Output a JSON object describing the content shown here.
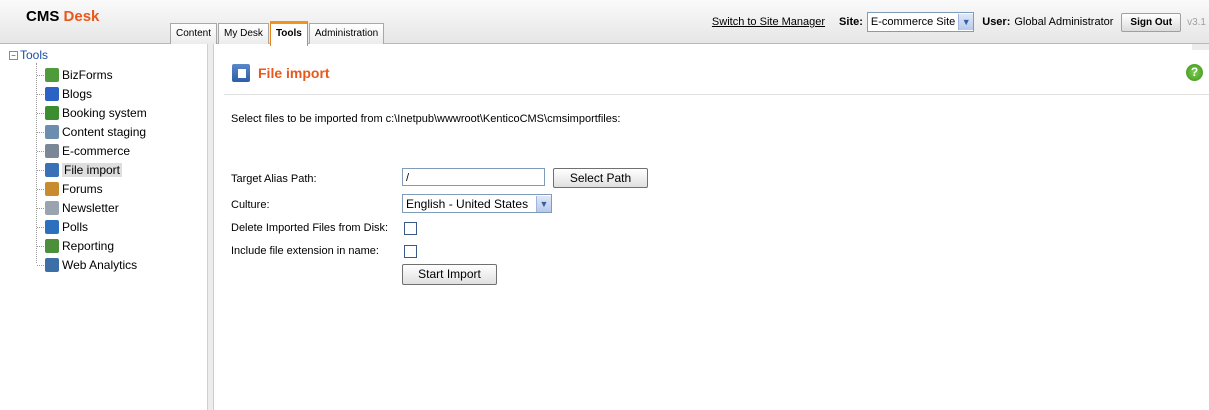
{
  "header": {
    "logo_cms": "CMS",
    "logo_desk": "Desk",
    "tabs": [
      "Content",
      "My Desk",
      "Tools",
      "Administration"
    ],
    "active_tab": "Tools",
    "switch_link": "Switch to Site Manager",
    "site_label": "Site:",
    "site_value": "E-commerce Site",
    "user_label": "User:",
    "user_name": "Global Administrator",
    "signout_label": "Sign Out",
    "version": "v3.1"
  },
  "sidebar": {
    "root_label": "Tools",
    "items": [
      {
        "label": "BizForms",
        "icon": "bizforms-icon",
        "color": "#4f9a3a"
      },
      {
        "label": "Blogs",
        "icon": "blogs-icon",
        "color": "#2b63c4"
      },
      {
        "label": "Booking system",
        "icon": "booking-icon",
        "color": "#3c8d2f"
      },
      {
        "label": "Content staging",
        "icon": "staging-icon",
        "color": "#6d8db0"
      },
      {
        "label": "E-commerce",
        "icon": "ecommerce-icon",
        "color": "#7a8796"
      },
      {
        "label": "File import",
        "icon": "file-import-icon",
        "color": "#3a70b8",
        "selected": true
      },
      {
        "label": "Forums",
        "icon": "forums-icon",
        "color": "#c88c2e"
      },
      {
        "label": "Newsletter",
        "icon": "newsletter-icon",
        "color": "#9aa4b0"
      },
      {
        "label": "Polls",
        "icon": "polls-icon",
        "color": "#2d6fbf"
      },
      {
        "label": "Reporting",
        "icon": "reporting-icon",
        "color": "#4b8f3a"
      },
      {
        "label": "Web Analytics",
        "icon": "web-analytics-icon",
        "color": "#3c6fa8"
      }
    ]
  },
  "main": {
    "title": "File import",
    "help_label": "?",
    "description": "Select files to be imported from c:\\Inetpub\\wwwroot\\KenticoCMS\\cmsimportfiles:",
    "target_alias_label": "Target Alias Path:",
    "target_alias_value": "/",
    "select_path_label": "Select Path",
    "culture_label": "Culture:",
    "culture_value": "English - United States",
    "delete_label": "Delete Imported Files from Disk:",
    "include_ext_label": "Include file extension in name:",
    "start_import_label": "Start Import"
  },
  "colors": {
    "accent": "#e8581b",
    "link": "#1d4ea5"
  }
}
